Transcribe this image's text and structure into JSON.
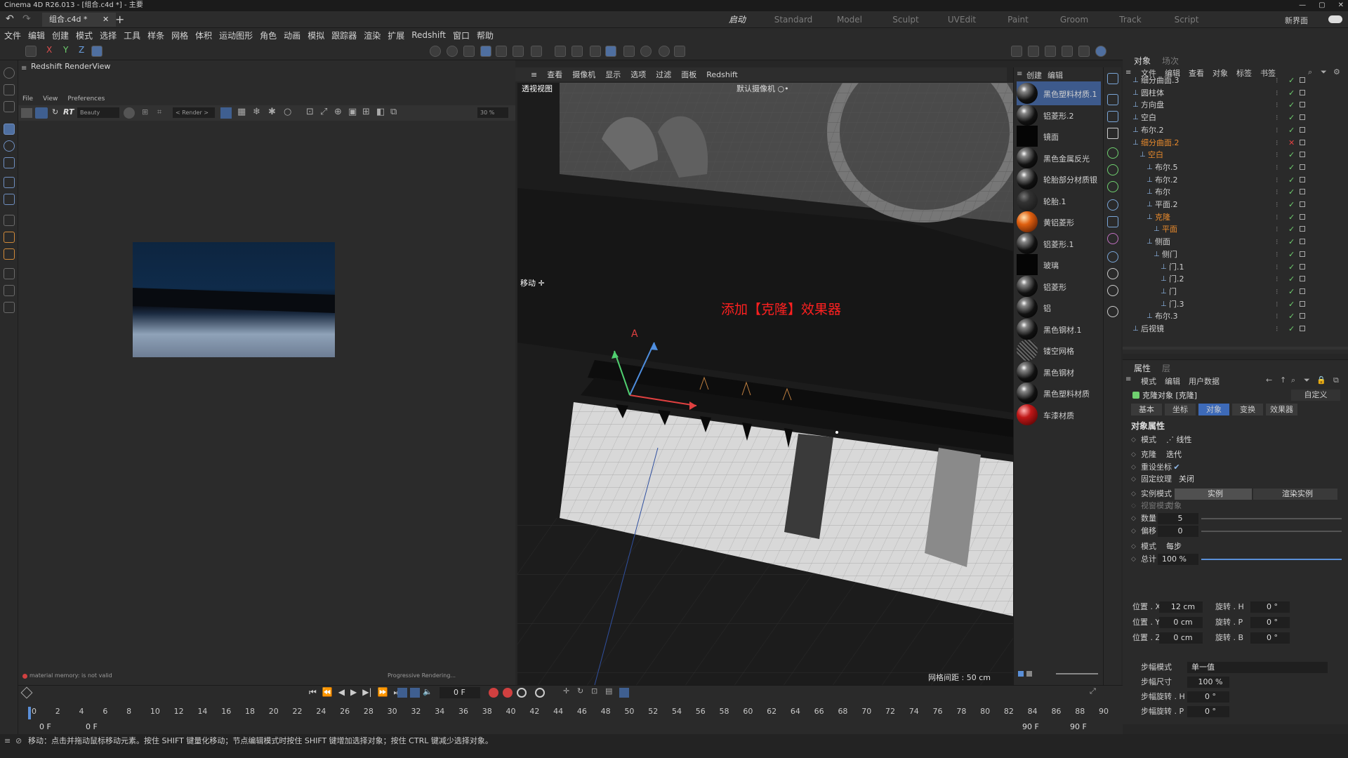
{
  "window": {
    "title": "Cinema 4D R26.013 - [组合.c4d *] - 主要"
  },
  "tabs": {
    "document": "组合.c4d *",
    "layouts": [
      "启动",
      "Standard",
      "Model",
      "Sculpt",
      "UVEdit",
      "Paint",
      "Groom",
      "Track",
      "Script"
    ],
    "active_layout": "启动",
    "new_interface": "新界面"
  },
  "menu": [
    "文件",
    "编辑",
    "创建",
    "模式",
    "选择",
    "工具",
    "样条",
    "网格",
    "体积",
    "运动图形",
    "角色",
    "动画",
    "模拟",
    "跟踪器",
    "渲染",
    "扩展",
    "Redshift",
    "窗口",
    "帮助"
  ],
  "toolbar": {
    "axis_x": "X",
    "axis_y": "Y",
    "axis_z": "Z"
  },
  "renderview": {
    "title": "Redshift RenderView",
    "menu": [
      "File",
      "View",
      "Preferences"
    ],
    "rt_label": "RT",
    "beauty": "Beauty",
    "render_label": "< Render >",
    "zoom": "30 %",
    "status_left": "material  memory: is not valid",
    "status_right": "Progressive Rendering..."
  },
  "viewport": {
    "menu": [
      "查看",
      "摄像机",
      "显示",
      "选项",
      "过滤",
      "面板",
      "Redshift"
    ],
    "label": "透视视图",
    "camera": "默认摄像机 ○•",
    "move_label": "移动 ✛",
    "annotation": "添加【克隆】效果器",
    "grid_info": "网格间距 : 50 cm"
  },
  "materials": {
    "menu": [
      "创建",
      "编辑"
    ],
    "items": [
      {
        "name": "黑色塑料材质.1",
        "style": "glossy",
        "selected": true
      },
      {
        "name": "铝菱形.2",
        "style": "glossy"
      },
      {
        "name": "镜面",
        "style": "black"
      },
      {
        "name": "黑色金属反光",
        "style": "glossy"
      },
      {
        "name": "轮胎部分材质银",
        "style": "glossy"
      },
      {
        "name": "轮胎.1",
        "style": "dark"
      },
      {
        "name": "黄铝菱形",
        "style": "orange"
      },
      {
        "name": "铝菱形.1",
        "style": "glossy"
      },
      {
        "name": "玻璃",
        "style": "black"
      },
      {
        "name": "铝菱形",
        "style": "glossy"
      },
      {
        "name": "铝",
        "style": "glossy"
      },
      {
        "name": "黑色钢材.1",
        "style": "glossy"
      },
      {
        "name": "镂空网格",
        "style": "mesh"
      },
      {
        "name": "黑色钢材",
        "style": "glossy"
      },
      {
        "name": "黑色塑料材质",
        "style": "glossy"
      },
      {
        "name": "车漆材质",
        "style": "red"
      }
    ]
  },
  "objects": {
    "tabs": [
      "对象",
      "场次"
    ],
    "menu": [
      "文件",
      "编辑",
      "查看",
      "对象",
      "标签",
      "书签"
    ],
    "rows": [
      {
        "name": "细分曲面.3",
        "depth": 0,
        "orange": false
      },
      {
        "name": "圆柱体",
        "depth": 0,
        "orange": false
      },
      {
        "name": "方向盘",
        "depth": 0,
        "orange": false
      },
      {
        "name": "空白",
        "depth": 0,
        "orange": false
      },
      {
        "name": "布尔.2",
        "depth": 0,
        "orange": false
      },
      {
        "name": "细分曲面.2",
        "depth": 0,
        "orange": true
      },
      {
        "name": "空白",
        "depth": 1,
        "orange": true
      },
      {
        "name": "布尔.5",
        "depth": 2,
        "orange": false
      },
      {
        "name": "布尔.2",
        "depth": 2,
        "orange": false
      },
      {
        "name": "布尔",
        "depth": 2,
        "orange": false
      },
      {
        "name": "平面.2",
        "depth": 2,
        "orange": false
      },
      {
        "name": "克隆",
        "depth": 2,
        "orange": true
      },
      {
        "name": "平面",
        "depth": 3,
        "orange": true
      },
      {
        "name": "侧面",
        "depth": 2,
        "orange": false
      },
      {
        "name": "侧门",
        "depth": 3,
        "orange": false
      },
      {
        "name": "门.1",
        "depth": 4,
        "orange": false
      },
      {
        "name": "门.2",
        "depth": 4,
        "orange": false
      },
      {
        "name": "门",
        "depth": 4,
        "orange": false
      },
      {
        "name": "门.3",
        "depth": 4,
        "orange": false
      },
      {
        "name": "布尔.3",
        "depth": 2,
        "orange": false
      },
      {
        "name": "后视镜",
        "depth": 0,
        "orange": false
      }
    ]
  },
  "attributes": {
    "tabs": [
      "属性",
      "层"
    ],
    "menu": [
      "模式",
      "编辑",
      "用户数据"
    ],
    "object_title": "克隆对象 [克隆]",
    "custom": "自定义",
    "subtabs": [
      "基本",
      "坐标",
      "对象",
      "变换",
      "效果器"
    ],
    "active_subtab": "对象",
    "section": "对象属性",
    "props": [
      {
        "label": "模式",
        "value": "⋰ 线性"
      },
      {
        "label": "克隆",
        "value": "迭代"
      },
      {
        "label": "重设坐标",
        "value": "✔"
      },
      {
        "label": "固定纹理",
        "value": "关闭"
      },
      {
        "label": "实例模式",
        "value": "实例",
        "value2": "渲染实例"
      },
      {
        "label": "视窗模式",
        "value": "对象"
      },
      {
        "label": "数量",
        "value": "5"
      },
      {
        "label": "偏移",
        "value": "0"
      },
      {
        "label": "模式",
        "value": "每步"
      },
      {
        "label": "总计",
        "value": "100 %"
      }
    ],
    "transform": [
      {
        "pos_label": "位置 . X",
        "pos": "12 cm",
        "rot_label": "旋转 . H",
        "rot": "0 °"
      },
      {
        "pos_label": "位置 . Y",
        "pos": "0 cm",
        "rot_label": "旋转 . P",
        "rot": "0 °"
      },
      {
        "pos_label": "位置 . Z",
        "pos": "0 cm",
        "rot_label": "旋转 . B",
        "rot": "0 °"
      }
    ],
    "step": [
      {
        "label": "步幅模式",
        "value": "单一值"
      },
      {
        "label": "步幅尺寸",
        "value": "100 %"
      },
      {
        "label": "步幅旋转 . H",
        "value": "0 °"
      },
      {
        "label": "步幅旋转 . P",
        "value": "0 °"
      }
    ]
  },
  "timeline": {
    "current": "0 F",
    "ticks": [
      "0",
      "2",
      "4",
      "6",
      "8",
      "10",
      "12",
      "14",
      "16",
      "18",
      "20",
      "22",
      "24",
      "26",
      "28",
      "30",
      "32",
      "34",
      "36",
      "38",
      "40",
      "42",
      "44",
      "46",
      "48",
      "50",
      "52",
      "54",
      "56",
      "58",
      "60",
      "62",
      "64",
      "66",
      "68",
      "70",
      "72",
      "74",
      "76",
      "78",
      "80",
      "82",
      "84",
      "86",
      "88",
      "90"
    ],
    "start": "0 F",
    "start2": "0 F",
    "end": "90 F",
    "end2": "90 F"
  },
  "status": "移动：点击并拖动鼠标移动元素。按住 SHIFT 键量化移动；节点编辑模式时按住 SHIFT 键增加选择对象；按住 CTRL 键减少选择对象。"
}
